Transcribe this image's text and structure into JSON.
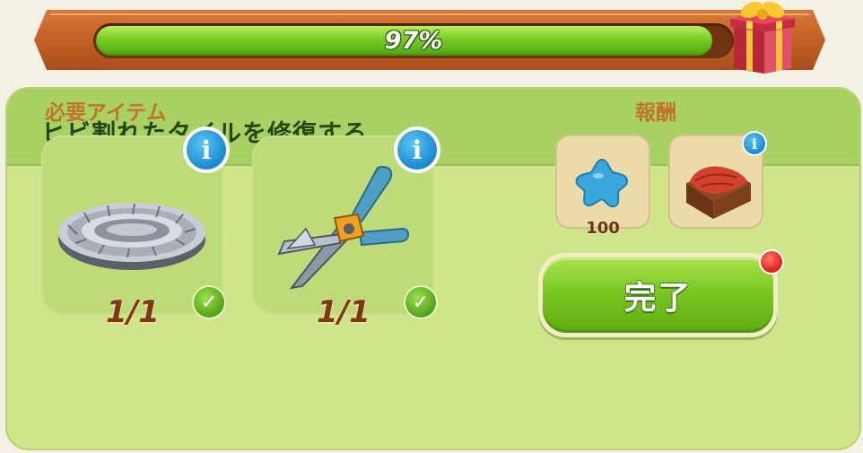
{
  "progress": {
    "label": "97%",
    "value": 0.97,
    "fill_color": "#78cc22",
    "reward_icon": "gift-box-icon"
  },
  "task": {
    "title": "ヒビ割れたタイルを修復する"
  },
  "required": {
    "label": "必要アイテム",
    "items": [
      {
        "icon": "stone-tile-icon",
        "count": "1/1",
        "info_icon": "info-icon",
        "status_icon": "checkmark-icon"
      },
      {
        "icon": "pruning-shears-icon",
        "count": "1/1",
        "info_icon": "info-icon",
        "status_icon": "checkmark-icon"
      }
    ]
  },
  "rewards": {
    "label": "報酬",
    "items": [
      {
        "icon": "blue-star-icon",
        "amount": "100"
      },
      {
        "icon": "red-cloth-crate-icon",
        "info_icon": "info-icon"
      }
    ]
  },
  "complete_button": {
    "label": "完了",
    "color": "#76c41e",
    "badge_icon": "red-notification-dot"
  }
}
